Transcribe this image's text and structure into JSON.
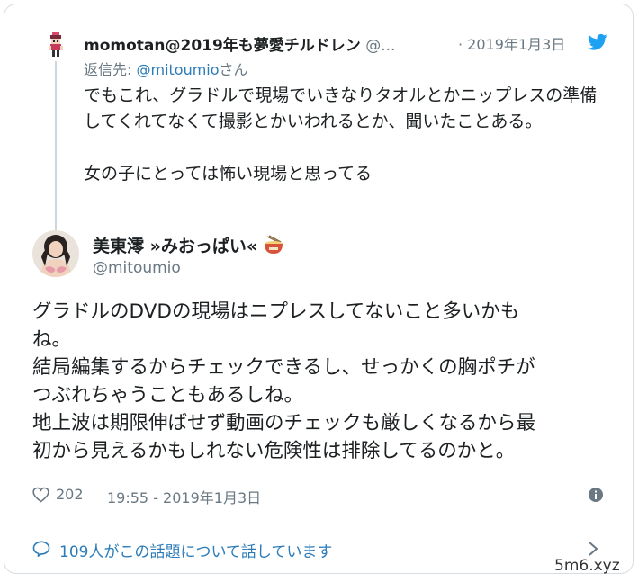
{
  "parent_tweet": {
    "author_name": "momotan@2019年も夢愛チルドレン",
    "author_handle": "@...",
    "date": "· 2019年1月3日",
    "reply_prefix": "返信先: ",
    "reply_handle": "@mitoumio",
    "reply_suffix": "さん",
    "paragraphs": [
      "でもこれ、グラドルで現場でいきなりタオルとかニップレスの準備してくれてなくて撮影とかいわれるとか、聞いたことある。",
      "女の子にとっては怖い現場と思ってる"
    ],
    "avatar_icon": "pixel-character-avatar",
    "brand_icon": "twitter-bird-icon"
  },
  "main_tweet": {
    "author_name": "美東澪 »みおっぱい«",
    "author_handle": "@mitoumio",
    "name_emoji_icon": "ramen-bowl-icon",
    "lines": [
      "グラドルのDVDの現場はニプレスしてないこと多いかも",
      "ね。",
      "結局編集するからチェックできるし、せっかくの胸ポチが",
      "つぶれちゃうこともあるしね。",
      "地上波は期限伸ばせず動画のチェックも厳しくなるから最",
      "初から見えるかもしれない危険性は排除してるのかと。"
    ],
    "likes": "202",
    "timestamp": "19:55 - 2019年1月3日"
  },
  "footer": {
    "conversation_text": "109人がこの話題について話しています"
  },
  "watermark": "5m6.xyz",
  "colors": {
    "link": "#2b7bb9",
    "muted": "#697882",
    "text": "#1c2022",
    "border": "#d6dde3"
  }
}
